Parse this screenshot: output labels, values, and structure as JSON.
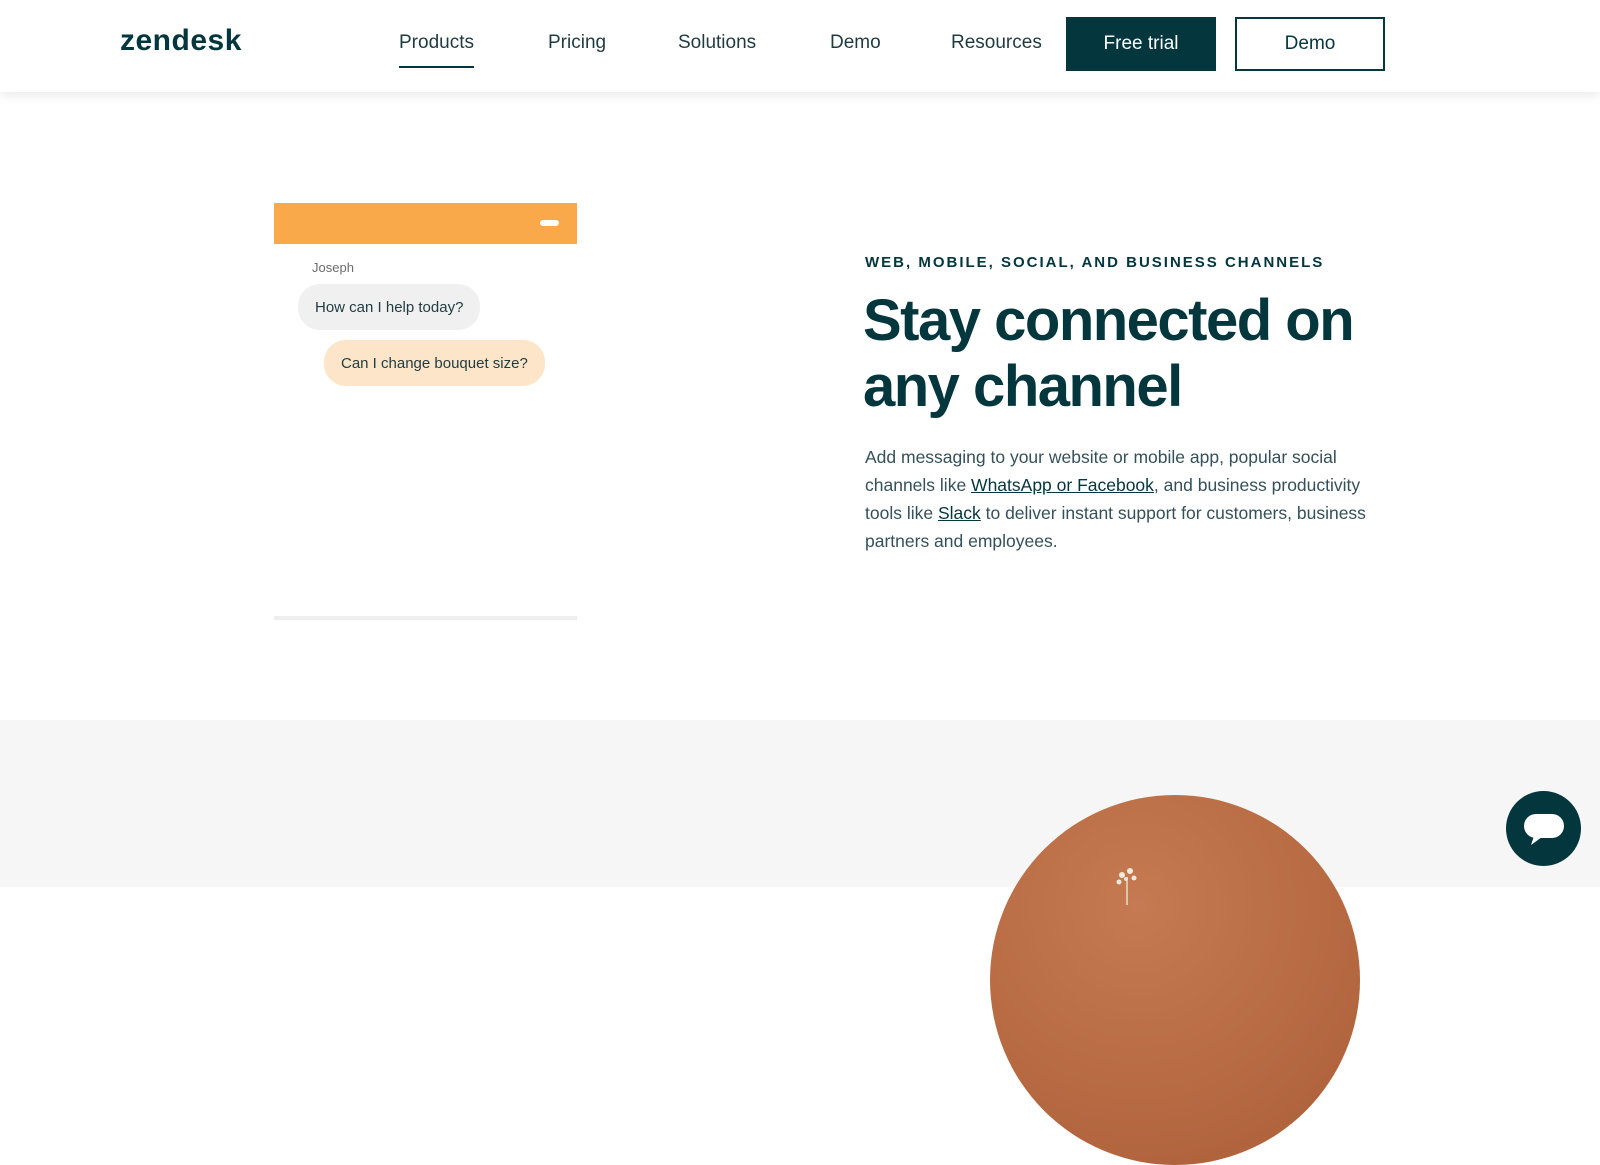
{
  "header": {
    "logo": "zendesk",
    "nav": [
      {
        "label": "Products",
        "active": true
      },
      {
        "label": "Pricing"
      },
      {
        "label": "Solutions"
      },
      {
        "label": "Demo"
      },
      {
        "label": "Resources"
      }
    ],
    "cta_primary": "Free trial",
    "cta_secondary": "Demo"
  },
  "chat_preview": {
    "accent_color": "#f9a84a",
    "author": "Joseph",
    "agent_message": "How can I help today?",
    "user_message": "Can I change bouquet size?"
  },
  "content": {
    "eyebrow": "WEB, MOBILE, SOCIAL, AND BUSINESS CHANNELS",
    "headline": "Stay connected on any channel",
    "body_part1": "Add messaging to your website or mobile app, popular social channels like ",
    "link1": "WhatsApp or Facebook",
    "body_part2": ", and business productivity tools like ",
    "link2": "Slack",
    "body_part3": " to deliver instant support for customers, business partners and employees."
  },
  "colors": {
    "brand": "#03363d",
    "accent": "#f9a84a",
    "user_bubble": "#fde5c9",
    "agent_bubble": "#f0f0f0"
  },
  "icons": {
    "launcher": "chat-bubble-icon"
  }
}
